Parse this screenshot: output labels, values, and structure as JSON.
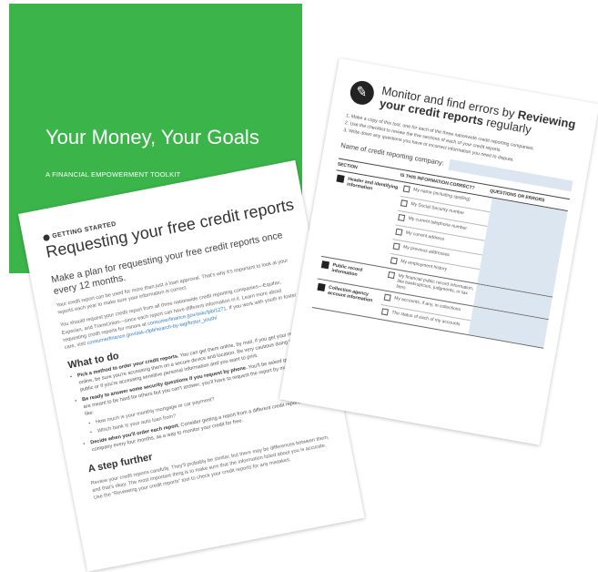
{
  "cover": {
    "title": "Your Money, Your Goals",
    "subtitle": "A FINANCIAL EMPOWERMENT TOOLKIT",
    "color": "#3bb54a"
  },
  "left_sheet": {
    "section_label": "GETTING STARTED",
    "heading": "Requesting your free credit reports",
    "lead": "Make a plan for requesting your free credit reports once every 12 months.",
    "para1": "Your credit report can be used for more than just a loan approval. That's why it's important to look at your reports each year to make sure your information is correct.",
    "para2": "You should request your credit report from all three nationwide credit reporting companies—Equifax, Experian, and TransUnion—since each report can have different information in it. Learn more about requesting credit reports for minors at",
    "link": "consumerfinance.gov/askcfpb/1271",
    "para2_end": ". If you work with youth in foster care, visit",
    "link2": "consumerfinance.gov/ask-cfpb/search-by-tag/foster_youth/",
    "what_to_do": "What to do",
    "b1_bold": "Pick a method to order your credit reports.",
    "b1": "You can get them online, by mail, if you get your reports online, be sure you're accessing them on a secure device and location. Be very cautious doing this on public or if you're accessing sensitive personal information and you want to print.",
    "b2_bold": "Be ready to answer some security questions if you request by phone.",
    "b2": "You'll be asked questions that are meant to be hard for others but you can't answer, you'll have to request the report by mail. Questions like:",
    "sub1": "How much is your monthly mortgage or car payment?",
    "sub2": "Which bank is your auto loan from?",
    "b3_bold": "Decide when you'll order each report.",
    "b3": "Consider getting a report from a different credit reporting company every four months, as a way to monitor your credit for free.",
    "step_further": "A step further",
    "para3": "Review your credit reports carefully. They'll probably be similar, but there may be differences between them, and that's okay. The most important thing is to make sure that the information listed about you is accurate. Use the “Reviewing your credit reports” tool to check your credit reports for any mistakes."
  },
  "right_sheet": {
    "title_line1": "Monitor and find errors by ",
    "title_bold1": "Reviewing",
    "title_bold2": "your credit reports",
    "title_line2_end": " regularly",
    "step1": "1.  Make a copy of this tool, one for each of the three nationwide credit reporting companies.",
    "step2": "2.  Use the checklist to review the five sections of each of your credit reports.",
    "step3": "3.  Write down any questions you have or incorrect information you need to dispute.",
    "company_label": "Name of credit reporting company:",
    "col_section": "SECTION",
    "col_correct": "IS THIS INFORMATION CORRECT?",
    "col_questions": "QUESTIONS OR ERRORS",
    "sections": [
      {
        "name": "Header and identifying information",
        "items": [
          "My name (including spelling)",
          "My Social Security number",
          "My current telephone number",
          "My current address",
          "My previous addresses",
          "My employment history"
        ]
      },
      {
        "name": "Public record information",
        "items": [
          "My financial public record information, like bankruptcies, judgments, or tax liens"
        ]
      },
      {
        "name": "Collection agency account information",
        "items": [
          "My accounts, if any, in collections",
          "The status of each of my accounts"
        ]
      }
    ]
  }
}
